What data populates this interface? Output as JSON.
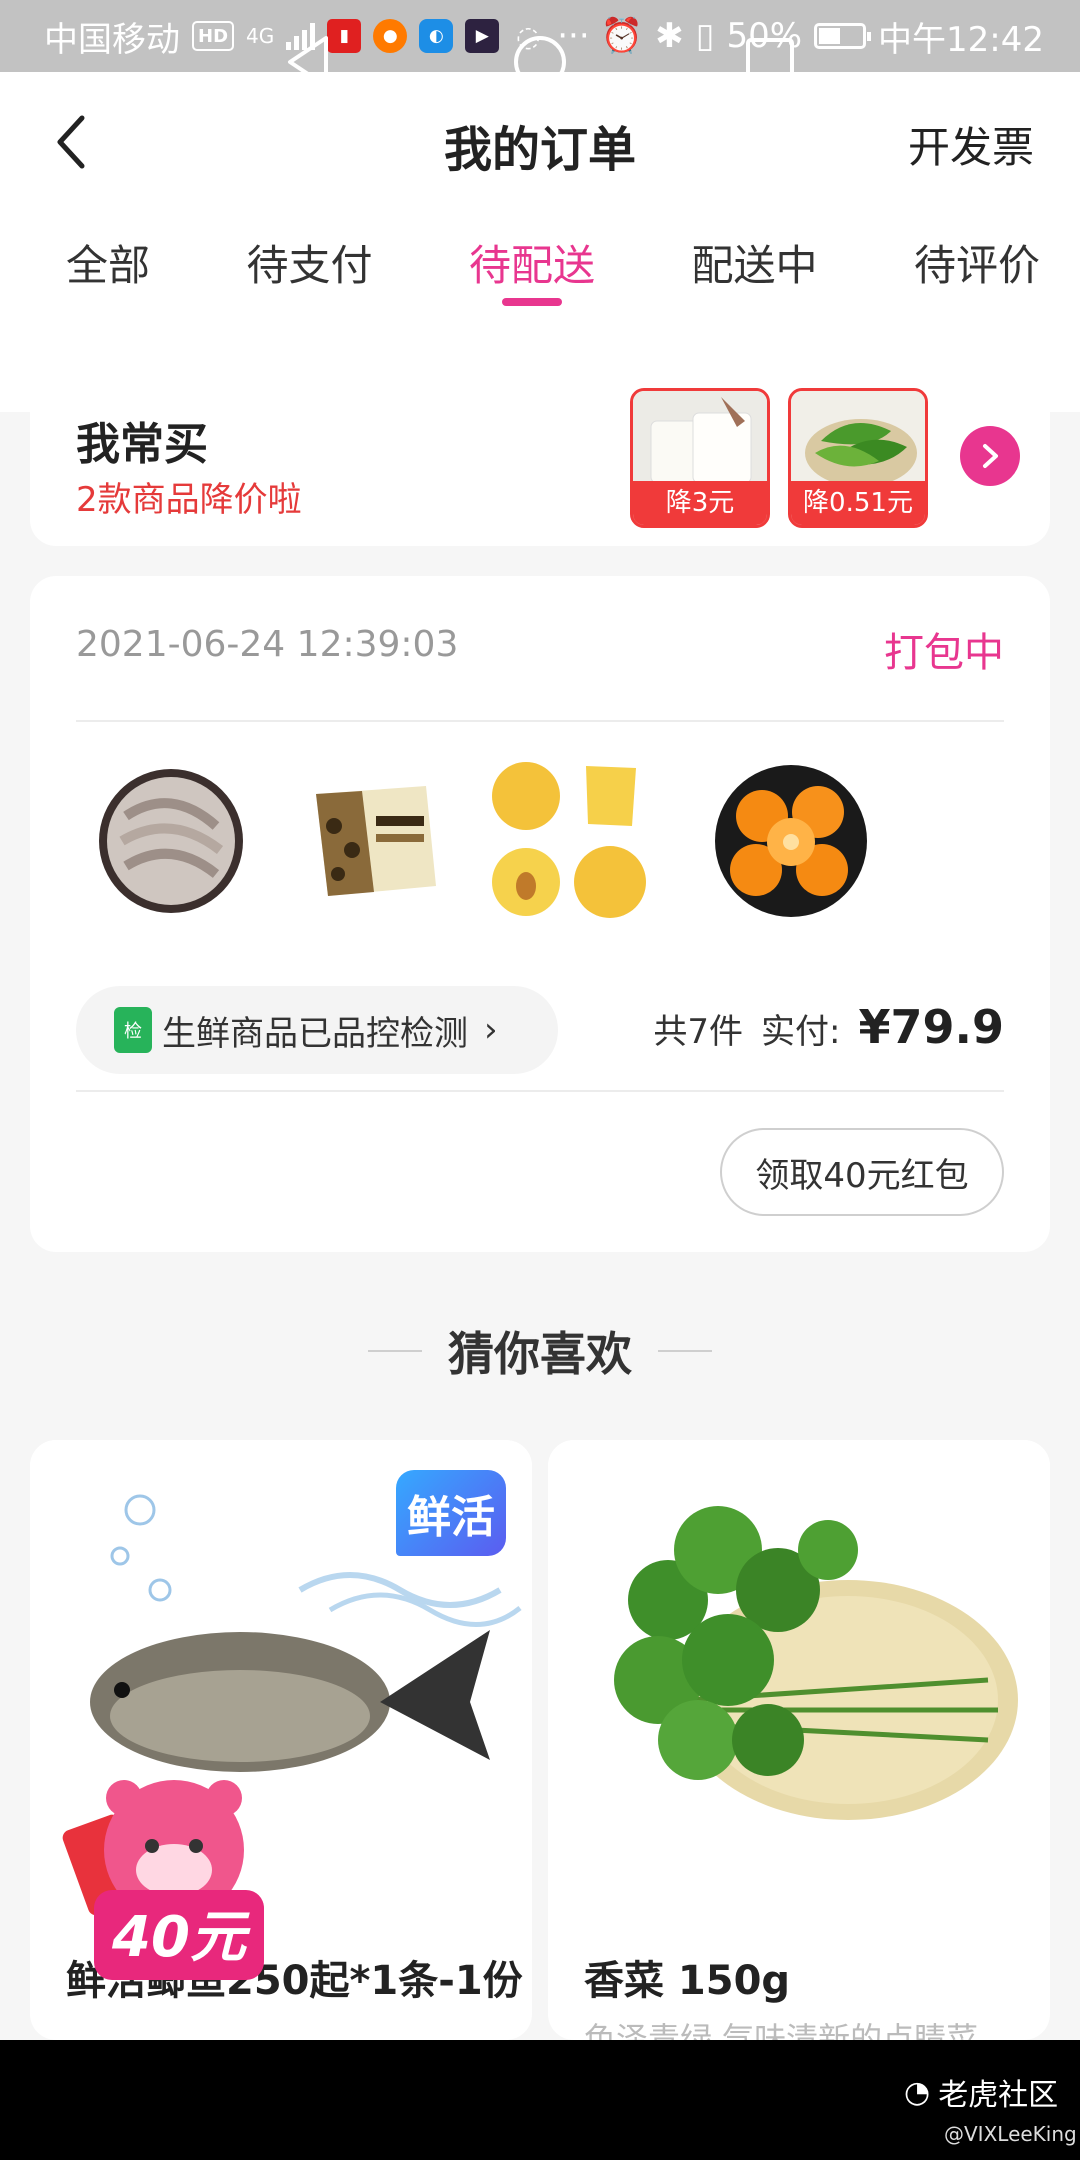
{
  "status_bar": {
    "carrier": "中国移动",
    "hd_label": "HD",
    "network": "4G",
    "battery_text": "50%",
    "battery_level": 0.5,
    "time": "中午12:42"
  },
  "header": {
    "title": "我的订单",
    "invoice_label": "开发票"
  },
  "tabs": [
    {
      "label": "全部",
      "active": false
    },
    {
      "label": "待支付",
      "active": false
    },
    {
      "label": "待配送",
      "active": true
    },
    {
      "label": "配送中",
      "active": false
    },
    {
      "label": "待评价",
      "active": false
    }
  ],
  "buy_often": {
    "title": "我常买",
    "subtitle": "2款商品降价啦",
    "items": [
      {
        "price_drop": "降3元",
        "icon": "tissue-product-icon"
      },
      {
        "price_drop": "降0.51元",
        "icon": "green-pepper-product-icon"
      }
    ]
  },
  "order": {
    "time": "2021-06-24 12:39:03",
    "status": "打包中",
    "products": [
      "shrimp-product-icon",
      "ice-cream-product-icon",
      "yellow-peach-product-icon",
      "orange-product-icon",
      "watermelon-product-icon"
    ],
    "qc_icon_text": "检",
    "qc_label": "生鲜商品已品控检测",
    "qc_arrow": "›",
    "count_text": "共7件",
    "paid_label": "实付:",
    "paid_amount": "¥79.9",
    "red_packet_button": "领取40元红包"
  },
  "guess": {
    "title": "猜你喜欢",
    "items": [
      {
        "name": "鲜活鲫鱼250起*1条-1份",
        "desc": "",
        "badge": "鲜活",
        "promo": "40元"
      },
      {
        "name": "香菜 150g",
        "desc": "色泽青绿 气味清新的点睛菜",
        "badge": "",
        "promo": ""
      }
    ]
  },
  "watermark": {
    "brand": "老虎社区",
    "user": "@VIXLeeKing"
  },
  "colors": {
    "accent": "#e8368f",
    "price_red": "#e53a3a",
    "tag_red": "#f03a3a"
  }
}
